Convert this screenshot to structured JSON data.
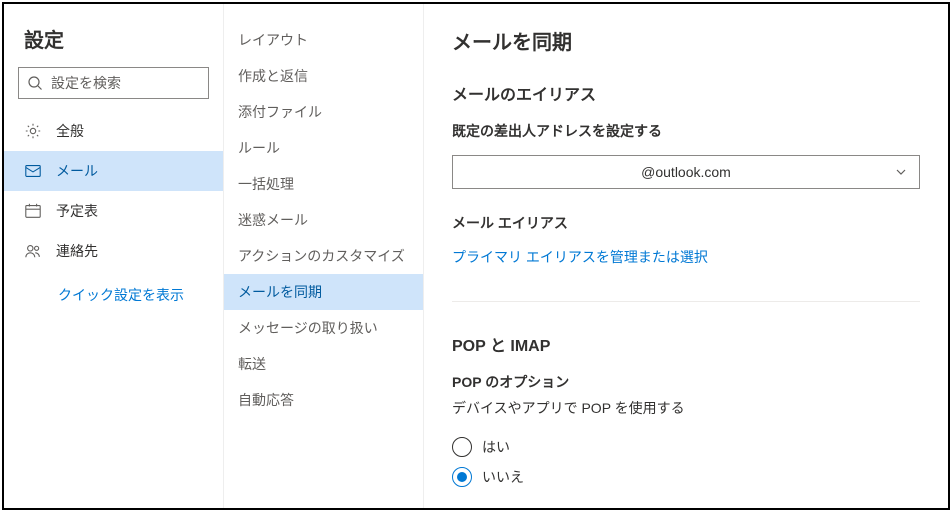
{
  "col1": {
    "title": "設定",
    "searchPlaceholder": "設定を検索",
    "items": [
      {
        "label": "全般"
      },
      {
        "label": "メール"
      },
      {
        "label": "予定表"
      },
      {
        "label": "連絡先"
      }
    ],
    "quickLink": "クイック設定を表示"
  },
  "col2": {
    "items": [
      {
        "label": "レイアウト"
      },
      {
        "label": "作成と返信"
      },
      {
        "label": "添付ファイル"
      },
      {
        "label": "ルール"
      },
      {
        "label": "一括処理"
      },
      {
        "label": "迷惑メール"
      },
      {
        "label": "アクションのカスタマイズ"
      },
      {
        "label": "メールを同期"
      },
      {
        "label": "メッセージの取り扱い"
      },
      {
        "label": "転送"
      },
      {
        "label": "自動応答"
      }
    ]
  },
  "main": {
    "title": "メールを同期",
    "aliasHeading": "メールのエイリアス",
    "defaultFromLabel": "既定の差出人アドレスを設定する",
    "dropdownValue": "@outlook.com",
    "aliasLabel": "メール エイリアス",
    "manageLink": "プライマリ エイリアスを管理または選択",
    "popHeading": "POP と IMAP",
    "popOptionsLabel": "POP のオプション",
    "popDesc": "デバイスやアプリで POP を使用する",
    "radioYes": "はい",
    "radioNo": "いいえ"
  }
}
